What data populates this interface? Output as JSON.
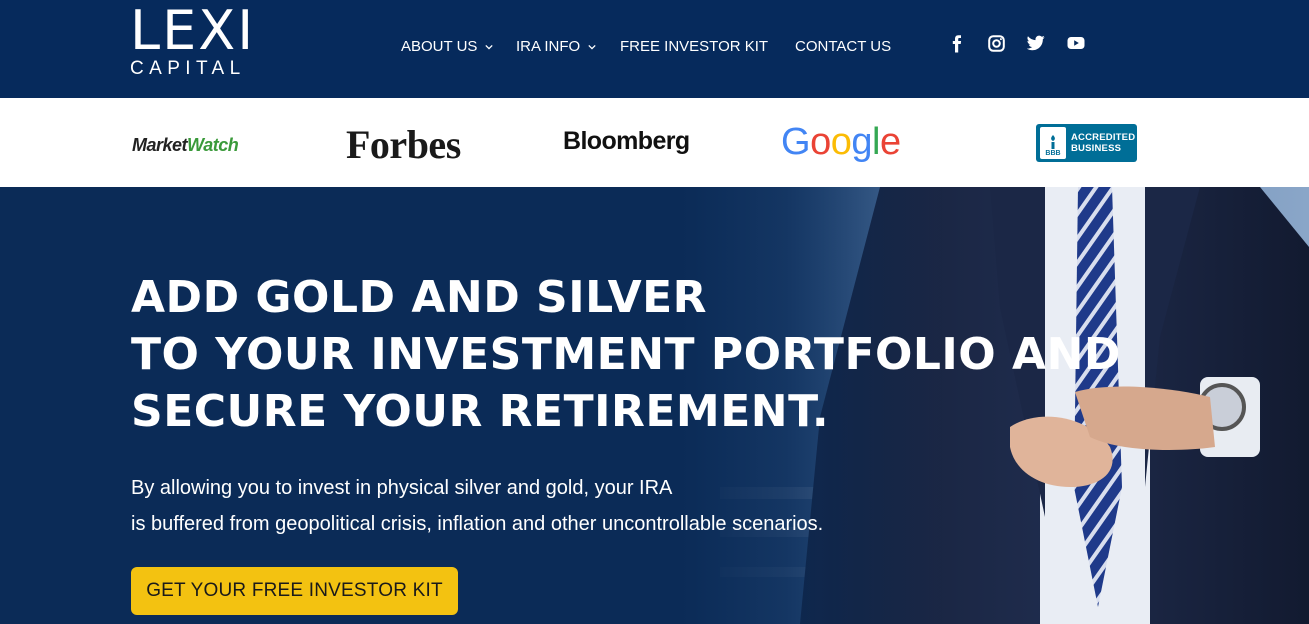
{
  "header": {
    "logo_main": "LEXI",
    "logo_sub": "CAPITAL",
    "nav": [
      {
        "label": "ABOUT US",
        "has_dropdown": true
      },
      {
        "label": "IRA INFO",
        "has_dropdown": true
      },
      {
        "label": "FREE INVESTOR KIT",
        "has_dropdown": false
      },
      {
        "label": "CONTACT US",
        "has_dropdown": false
      }
    ],
    "social_icons": [
      "facebook-icon",
      "instagram-icon",
      "twitter-icon",
      "youtube-icon"
    ]
  },
  "press": {
    "marketwatch_a": "Market",
    "marketwatch_b": "Watch",
    "forbes": "Forbes",
    "bloomberg": "Bloomberg",
    "google": [
      "G",
      "o",
      "o",
      "g",
      "l",
      "e"
    ],
    "bbb_seal": "BBB",
    "bbb_line1": "ACCREDITED",
    "bbb_line2": "BUSINESS"
  },
  "hero": {
    "headline": [
      "ADD GOLD AND SILVER",
      "TO YOUR INVESTMENT PORTFOLIO AND",
      "SECURE YOUR RETIREMENT."
    ],
    "subtext": [
      "By allowing you to invest in physical silver and gold, your IRA",
      "is buffered from geopolitical crisis, inflation and other uncontrollable scenarios."
    ],
    "cta_label": "GET YOUR FREE INVESTOR KIT"
  },
  "colors": {
    "header_bg": "#062a5c",
    "hero_bg": "#0b2b57",
    "cta": "#f3c211",
    "bbb": "#006e97"
  }
}
